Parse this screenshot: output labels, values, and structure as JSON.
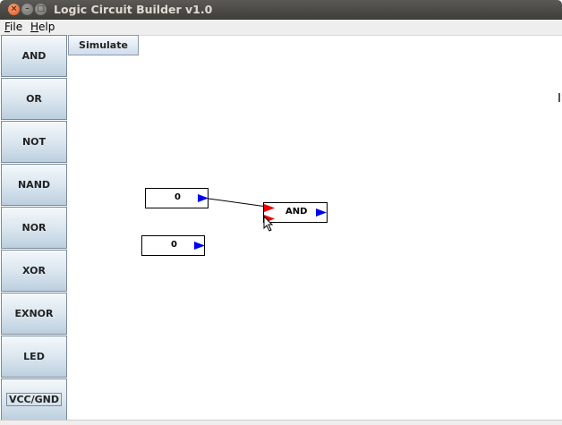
{
  "window": {
    "title": "Logic Circuit Builder v1.0",
    "close_glyph": "×",
    "min_glyph": "–",
    "max_glyph": "□"
  },
  "menu": {
    "file": {
      "mnemonic": "F",
      "rest": "ile"
    },
    "help": {
      "mnemonic": "H",
      "rest": "elp"
    }
  },
  "palette": {
    "and": "AND",
    "or": "OR",
    "not": "NOT",
    "nand": "NAND",
    "nor": "NOR",
    "xor": "XOR",
    "exnor": "EXNOR",
    "led": "LED",
    "vcc": "VCC/GND"
  },
  "toolbar": {
    "simulate": "Simulate"
  },
  "canvas": {
    "input1": {
      "value": "0"
    },
    "input2": {
      "value": "0"
    },
    "and_gate": {
      "label": "AND"
    }
  },
  "colors": {
    "output_port": "#0000ee",
    "input_port": "#ee0000",
    "wire": "#000000"
  },
  "icons": {
    "cursor": "mouse-pointer-icon"
  }
}
